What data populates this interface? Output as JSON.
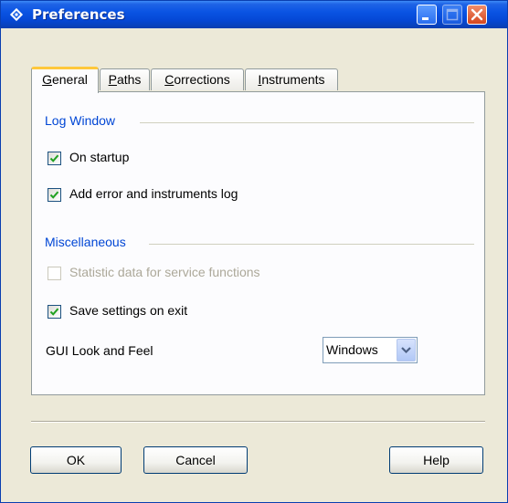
{
  "window": {
    "title": "Preferences",
    "app_icon": "preferences-app-icon",
    "controls": [
      "minimize-icon",
      "maximize-icon",
      "close-icon"
    ]
  },
  "tabs": [
    {
      "label": "General",
      "mnemonic": "G",
      "rest": "eneral",
      "active": true
    },
    {
      "label": "Paths",
      "mnemonic": "P",
      "rest": "aths",
      "active": false
    },
    {
      "label": "Corrections",
      "mnemonic": "C",
      "rest": "orrections",
      "active": false
    },
    {
      "label": "Instruments",
      "mnemonic": "I",
      "rest": "nstruments",
      "active": false
    }
  ],
  "log_window": {
    "heading": "Log Window",
    "options": [
      {
        "label": "On startup",
        "checked": true,
        "enabled": true
      },
      {
        "label": "Add error and instruments log",
        "checked": true,
        "enabled": true
      }
    ]
  },
  "miscellaneous": {
    "heading": "Miscellaneous",
    "options": [
      {
        "label": "Statistic data for service functions",
        "checked": false,
        "enabled": false
      },
      {
        "label": "Save settings on exit",
        "checked": true,
        "enabled": true
      }
    ],
    "look_and_feel": {
      "label": "GUI Look and Feel",
      "value": "Windows"
    }
  },
  "buttons": {
    "ok": "OK",
    "cancel": "Cancel",
    "help": "Help"
  },
  "colors": {
    "titlebar": "#0a54e3",
    "section_heading": "#0046d5",
    "active_tab_accent": "#ffc83c",
    "checkmark": "#21a121",
    "dialog_background": "#ece9d8"
  }
}
